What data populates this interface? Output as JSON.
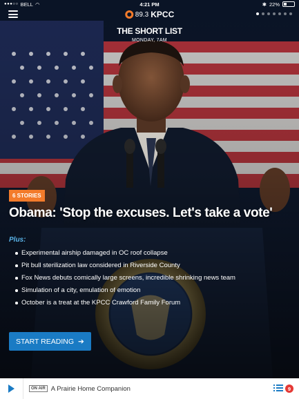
{
  "status_bar": {
    "carrier": "BELL",
    "time": "4:21 PM",
    "battery": "22%"
  },
  "nav": {
    "brand_freq": "89.3",
    "brand_name": "KPCC"
  },
  "short_list": {
    "title": "THE SHORT LIST",
    "time": "MONDAY, 7AM"
  },
  "story": {
    "badge": "6 STORIES",
    "headline": "Obama: 'Stop the excuses. Let's take a vote'",
    "plus_label": "Plus:",
    "items": [
      "Experimental airship damaged in OC roof collapse",
      "Pit bull sterilization law considered in Riverside County",
      "Fox News debuts comically large screens, incredible shrinking news team",
      "Simulation of a city, emulation of emotion",
      "October is a treat at the KPCC Crawford Family Forum"
    ],
    "cta": "START READING"
  },
  "player": {
    "onair": "ON AIR",
    "show": "A Prairie Home Companion",
    "queue_count": "9"
  },
  "colors": {
    "accent": "#f37b2b",
    "primary": "#1a7bc4",
    "plus": "#5ab4e8",
    "badge_count": "#e53935"
  }
}
